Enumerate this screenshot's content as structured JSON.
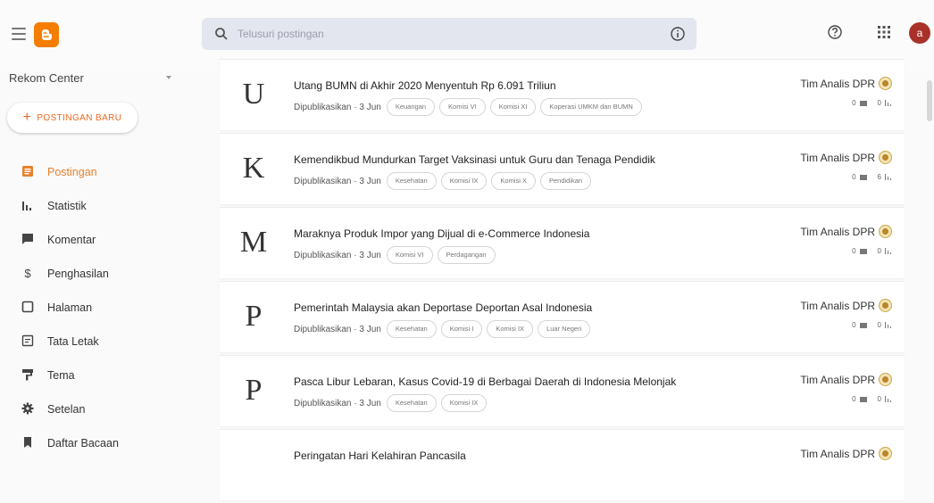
{
  "header": {
    "search_placeholder": "Telusuri postingan",
    "avatar_letter": "a",
    "brand_color": "#f57d00",
    "avatar_color": "#a8322a"
  },
  "sidebar": {
    "blog_name": "Rekom Center",
    "new_post_label": "POSTINGAN BARU",
    "items": [
      {
        "label": "Postingan",
        "icon": "posts-icon",
        "active": true
      },
      {
        "label": "Statistik",
        "icon": "stats-icon"
      },
      {
        "label": "Komentar",
        "icon": "comment-icon"
      },
      {
        "label": "Penghasilan",
        "icon": "dollar-icon"
      },
      {
        "label": "Halaman",
        "icon": "page-icon"
      },
      {
        "label": "Tata Letak",
        "icon": "layout-icon"
      },
      {
        "label": "Tema",
        "icon": "theme-icon"
      },
      {
        "label": "Setelan",
        "icon": "gear-icon"
      },
      {
        "label": "Daftar Bacaan",
        "icon": "bookmark-icon"
      }
    ],
    "accent_color": "#e8802c"
  },
  "posts": [
    {
      "letter": "U",
      "title": "Utang BUMN di Akhir 2020 Menyentuh Rp 6.091 Triliun",
      "status": "Dipublikasikan · 3 Jun",
      "tags": [
        "Keuangan",
        "Komisi VI",
        "Komisi XI",
        "Koperasi UMKM dan BUMN"
      ],
      "author": "Tim Analis DPR",
      "comments": "0",
      "views": "0"
    },
    {
      "letter": "K",
      "title": "Kemendikbud Mundurkan Target Vaksinasi untuk Guru dan Tenaga Pendidik",
      "status": "Dipublikasikan · 3 Jun",
      "tags": [
        "Kesehatan",
        "Komisi IX",
        "Komisi X",
        "Pendidikan"
      ],
      "author": "Tim Analis DPR",
      "comments": "0",
      "views": "6"
    },
    {
      "letter": "M",
      "title": "Maraknya Produk Impor yang Dijual di e-Commerce Indonesia",
      "status": "Dipublikasikan · 3 Jun",
      "tags": [
        "Komisi VI",
        "Perdagangan"
      ],
      "author": "Tim Analis DPR",
      "comments": "0",
      "views": "0"
    },
    {
      "letter": "P",
      "title": "Pemerintah Malaysia akan Deportase Deportan Asal Indonesia",
      "status": "Dipublikasikan · 3 Jun",
      "tags": [
        "Kesehatan",
        "Komisi I",
        "Komisi IX",
        "Luar Negeri"
      ],
      "author": "Tim Analis DPR",
      "comments": "0",
      "views": "0"
    },
    {
      "letter": "P",
      "title": "Pasca Libur Lebaran, Kasus Covid-19 di Berbagai Daerah di Indonesia Melonjak",
      "status": "Dipublikasikan · 3 Jun",
      "tags": [
        "Kesehatan",
        "Komisi IX"
      ],
      "author": "Tim Analis DPR",
      "comments": "0",
      "views": "0"
    },
    {
      "letter": "",
      "title": "Peringatan Hari Kelahiran Pancasila",
      "status": "",
      "tags": [],
      "author": "Tim Analis DPR",
      "comments": "",
      "views": ""
    }
  ]
}
